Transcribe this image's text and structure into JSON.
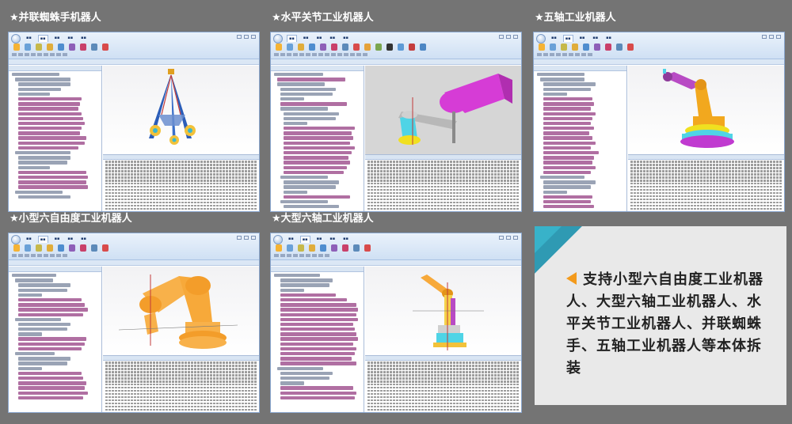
{
  "panels": [
    {
      "id": "parallel-spider",
      "title": "★并联蜘蛛手机器人"
    },
    {
      "id": "scara",
      "title": "★水平关节工业机器人"
    },
    {
      "id": "five-axis",
      "title": "★五轴工业机器人"
    },
    {
      "id": "small-six-axis",
      "title": "★小型六自由度工业机器人"
    },
    {
      "id": "large-six-axis",
      "title": "★大型六轴工业机器人"
    }
  ],
  "info": {
    "text": "支持小型六自由度工业机器人、大型六轴工业机器人、水平关节工业机器人、并联蜘蛛手、五轴工业机器人等本体拆装"
  },
  "colors": {
    "background": "#747474",
    "info_bg": "#e9e9e9",
    "accent_teal": "#2f9ab3",
    "accent_orange": "#f39a1c"
  }
}
